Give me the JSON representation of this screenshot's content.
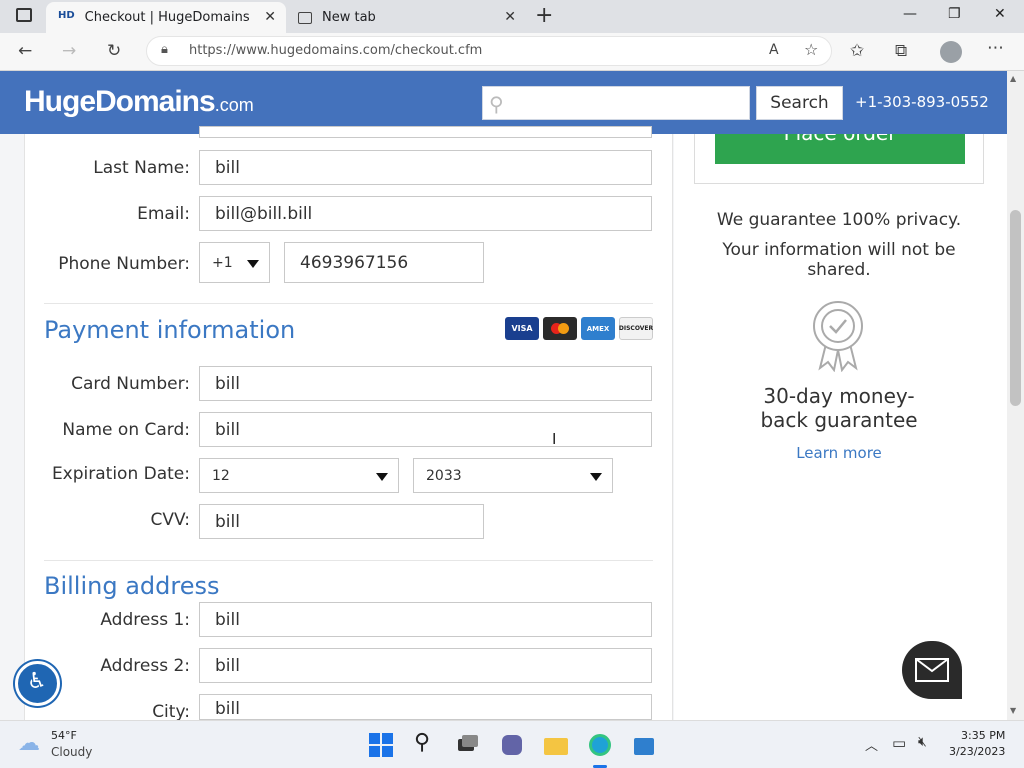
{
  "browser": {
    "tabs": [
      {
        "label": "Checkout | HugeDomains",
        "favicon": "HD"
      },
      {
        "label": "New tab"
      }
    ],
    "url": "https://www.hugedomains.com/checkout.cfm"
  },
  "header": {
    "logo_main": "HugeDomains",
    "logo_suffix": ".com",
    "search_placeholder": "",
    "search_button": "Search",
    "phone": "+1-303-893-0552"
  },
  "form": {
    "last_name_label": "Last Name:",
    "last_name_value": "bill",
    "email_label": "Email:",
    "email_value": "bill@bill.bill",
    "phone_label": "Phone Number:",
    "phone_code": "+1",
    "phone_value": "4693967156",
    "payment_title": "Payment information",
    "cards": [
      "VISA",
      "MC",
      "AMEX",
      "DISCOVER"
    ],
    "card_number_label": "Card Number:",
    "card_number_value": "bill",
    "name_on_card_label": "Name on Card:",
    "name_on_card_value": "bill",
    "expiration_label": "Expiration Date:",
    "exp_month": "12",
    "exp_year": "2033",
    "cvv_label": "CVV:",
    "cvv_value": "bill",
    "billing_title": "Billing address",
    "address1_label": "Address 1:",
    "address1_value": "bill",
    "address2_label": "Address 2:",
    "address2_value": "bill",
    "city_label": "City:",
    "city_value": "bill"
  },
  "sidebar": {
    "place_order": "Place order",
    "privacy_line1": "We guarantee 100% privacy.",
    "privacy_line2": "Your information will not be shared.",
    "money_back": "30-day money-back guarantee",
    "learn_more": "Learn more"
  },
  "taskbar": {
    "temperature": "54°F",
    "weather": "Cloudy",
    "time": "3:35 PM",
    "date": "3/23/2023"
  },
  "colors": {
    "header_blue": "#4472bc",
    "section_blue": "#3b78c3",
    "order_green": "#2ea44f"
  }
}
